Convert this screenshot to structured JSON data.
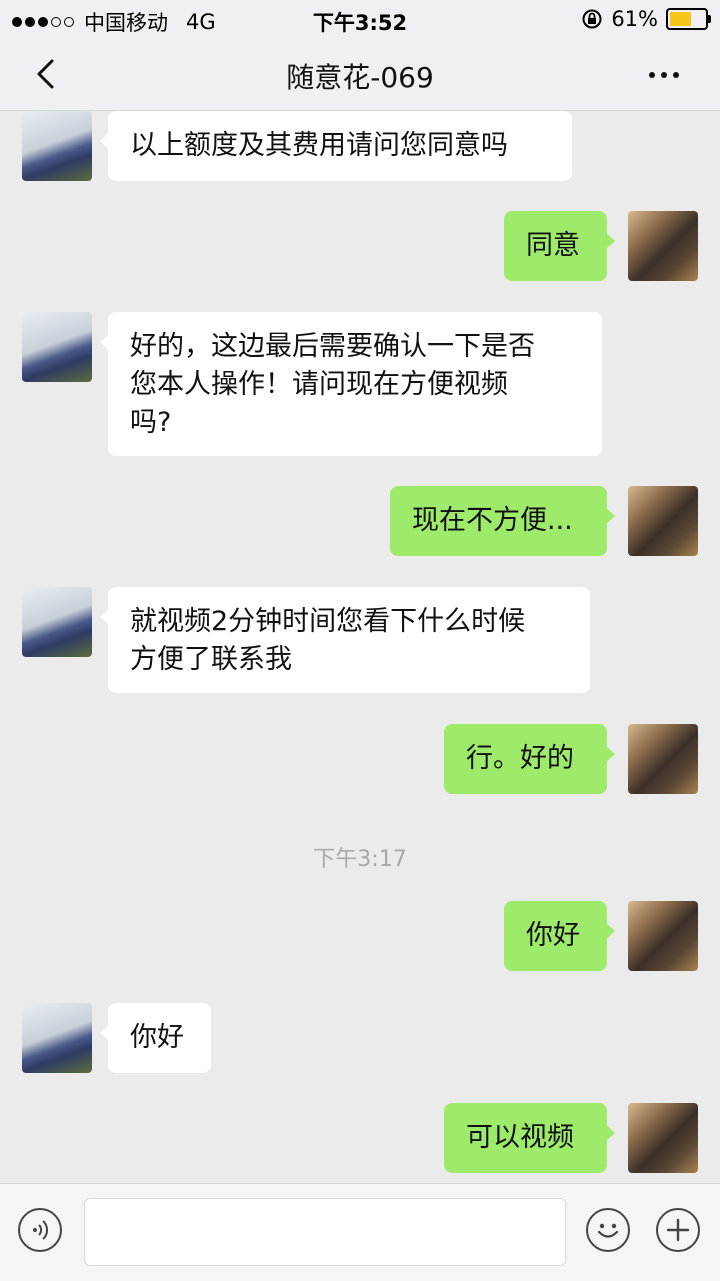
{
  "status_bar": {
    "carrier": "中国移动",
    "network": "4G",
    "time": "下午3:52",
    "battery_percent": "61%",
    "battery_level": 0.61,
    "signal_bars_filled": 3,
    "signal_bars_total": 5
  },
  "nav": {
    "title": "随意花-069",
    "back_icon": "chevron-left-icon",
    "more_icon": "more-horizontal-icon"
  },
  "messages": [
    {
      "from": "other",
      "text": "以上额度及其费用请问您同意吗"
    },
    {
      "from": "self",
      "text": "同意"
    },
    {
      "from": "other",
      "line1": "好的，这边最后需要确认一下是否",
      "line2": "您本人操作！请问现在方便视频",
      "line3": "吗?"
    },
    {
      "from": "self",
      "text": "现在不方便..."
    },
    {
      "from": "other",
      "line1": "就视频2分钟时间您看下什么时候",
      "line2": "方便了联系我"
    },
    {
      "from": "self",
      "text": "行。好的"
    },
    {
      "from": "self",
      "text": "你好"
    },
    {
      "from": "other",
      "text": "你好"
    },
    {
      "from": "self",
      "text": "可以视频"
    }
  ],
  "timestamp": "下午3:17",
  "input_bar": {
    "voice_icon": "voice-icon",
    "emoji_icon": "emoji-icon",
    "plus_icon": "plus-icon",
    "input_value": ""
  },
  "colors": {
    "self_bubble": "#9eea6a",
    "other_bubble": "#ffffff",
    "background": "#ebebeb"
  }
}
